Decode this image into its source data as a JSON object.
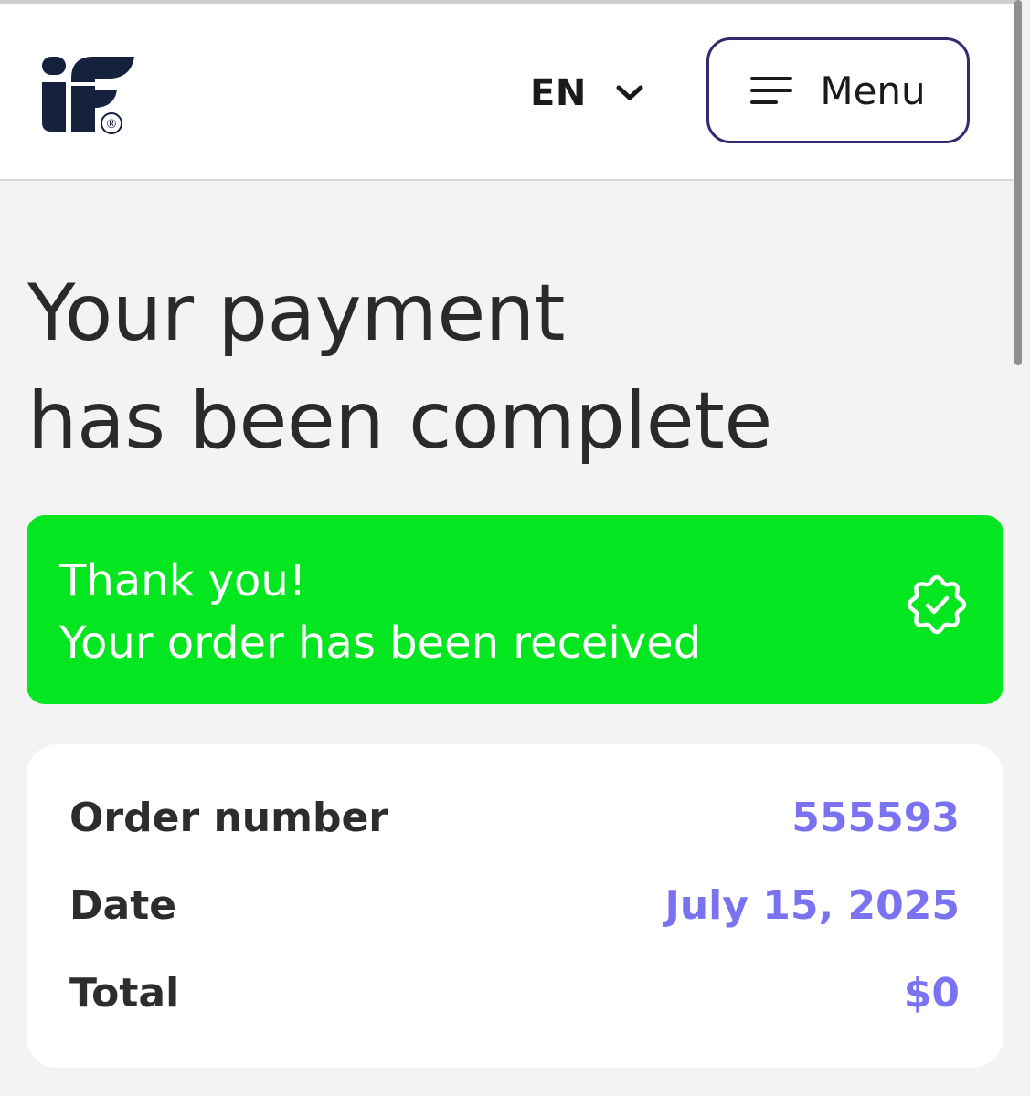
{
  "header": {
    "logo": {
      "text": "iF",
      "registered_mark": "®"
    },
    "language": {
      "selected": "EN",
      "icon": "chevron-down-icon"
    },
    "menu_button": {
      "label": "Menu",
      "icon": "hamburger-icon"
    }
  },
  "main": {
    "title_lines": [
      "Your payment",
      "has been complete"
    ],
    "success_banner": {
      "line1": "Thank you!",
      "line2": "Your order has been received",
      "icon": "check-badge-icon",
      "color": "#03e620"
    },
    "order_summary": {
      "rows": [
        {
          "label": "Order number",
          "value": "555593"
        },
        {
          "label": "Date",
          "value": "July 15, 2025"
        },
        {
          "label": "Total",
          "value": "$0"
        }
      ],
      "value_color": "#7b72f2"
    }
  },
  "colors": {
    "brand_navy": "#16213e",
    "menu_border": "#302c6e",
    "background": "#f3f3f3"
  }
}
